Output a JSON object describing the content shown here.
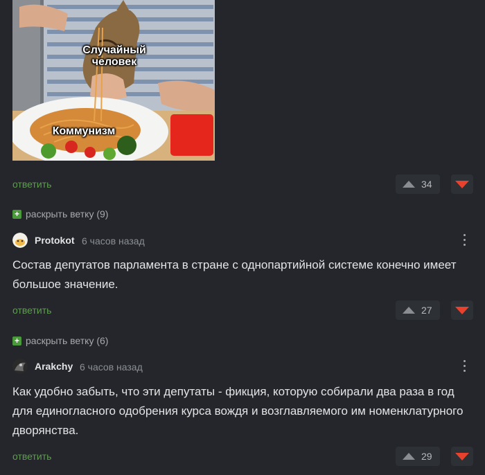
{
  "meme": {
    "caption_top": "Случайный человек",
    "caption_bottom": "Коммунизм"
  },
  "first_actions": {
    "reply_label": "ответить",
    "votes": "34"
  },
  "expand_1": {
    "label": "раскрыть ветку (9)"
  },
  "comment_1": {
    "author": "Protokot",
    "time": "6 часов назад",
    "text": "Состав депутатов парламента в стране с однопартийной системе конечно имеет большое значение.",
    "reply_label": "ответить",
    "votes": "27"
  },
  "expand_2": {
    "label": "раскрыть ветку (6)"
  },
  "comment_2": {
    "author": "Arakchy",
    "time": "6 часов назад",
    "text": "Как удобно забыть, что эти депутаты - фикция, которую собирали два раза в год для единогласного одобрения курса вождя и возглавляемого им номенклатурного дворянства.",
    "reply_label": "ответить",
    "votes": "29"
  },
  "colors": {
    "background": "#24262b",
    "reply_green": "#5e9d4f",
    "downvote_red": "#e8412e",
    "expand_plus_green": "#4a9a3c"
  },
  "icons": [
    "upvote-icon",
    "downvote-icon",
    "expand-plus-icon",
    "more-vertical-icon"
  ]
}
